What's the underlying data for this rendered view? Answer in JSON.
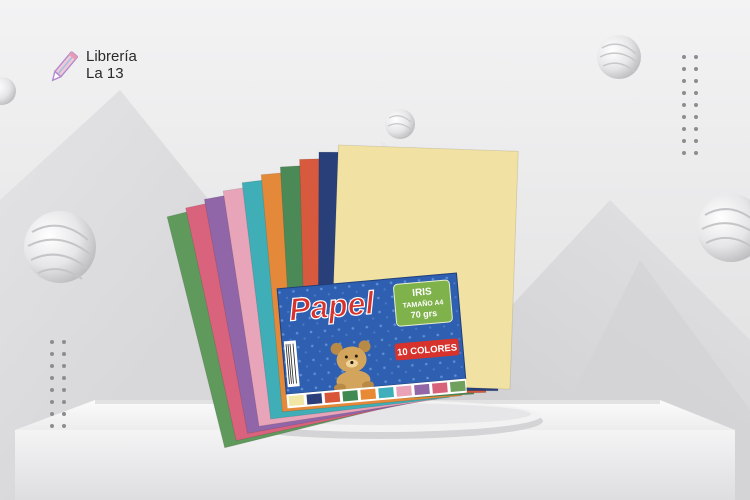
{
  "brand": {
    "line1": "Librería",
    "line2": "La 13",
    "icon": "pencil-icon"
  },
  "package": {
    "logo": "Papel",
    "badge_line1": "IRIS",
    "badge_line2": "TAMAÑO A4",
    "badge_line3": "70 grs",
    "count_label": "10 COLORES",
    "sheet_colors": [
      "#5f9a5c",
      "#d9637c",
      "#9166a8",
      "#e8a4b8",
      "#3faeb7",
      "#e4893a",
      "#4b8a57",
      "#d85a3e",
      "#283f79",
      "#f1e1a2"
    ],
    "swatch_colors": [
      "#f2e6a5",
      "#2c3e7a",
      "#d8553a",
      "#3f8a52",
      "#e88a35",
      "#3fb0bb",
      "#e9a2b8",
      "#9267a8",
      "#d9627b",
      "#6fa05e"
    ]
  }
}
